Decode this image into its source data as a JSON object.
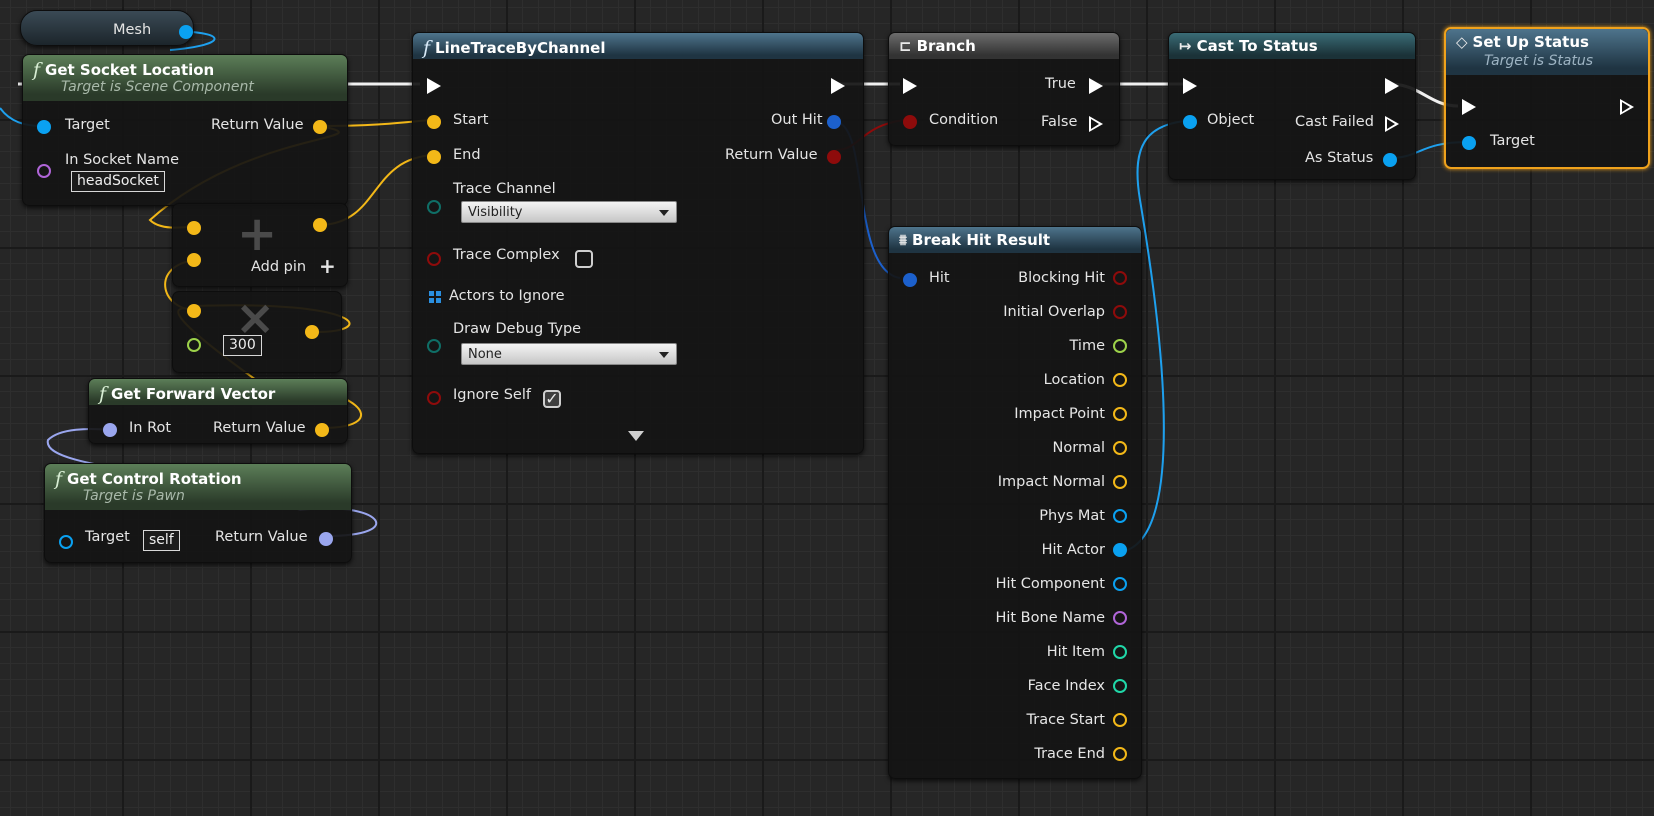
{
  "mesh_node": {
    "label": "Mesh"
  },
  "get_socket_location": {
    "title": "Get Socket Location",
    "subtitle": "Target is Scene Component",
    "target": "Target",
    "return_value": "Return Value",
    "in_socket_name": "In Socket Name",
    "socket_value": "headSocket"
  },
  "add_node": {
    "add_pin": "Add pin"
  },
  "multiply_node": {
    "value": "300"
  },
  "get_forward_vector": {
    "title": "Get Forward Vector",
    "in_rot": "In Rot",
    "return_value": "Return Value"
  },
  "get_control_rotation": {
    "title": "Get Control Rotation",
    "subtitle": "Target is Pawn",
    "target": "Target",
    "target_value": "self",
    "return_value": "Return Value"
  },
  "line_trace": {
    "title": "LineTraceByChannel",
    "start": "Start",
    "end": "End",
    "out_hit": "Out Hit",
    "return_value": "Return Value",
    "trace_channel": "Trace Channel",
    "trace_channel_value": "Visibility",
    "trace_complex": "Trace Complex",
    "actors_to_ignore": "Actors to Ignore",
    "draw_debug_type": "Draw Debug Type",
    "draw_debug_value": "None",
    "ignore_self": "Ignore Self"
  },
  "branch": {
    "title": "Branch",
    "condition": "Condition",
    "true_label": "True",
    "false_label": "False"
  },
  "cast_to_status": {
    "title": "Cast To Status",
    "object": "Object",
    "cast_failed": "Cast Failed",
    "as_status": "As Status"
  },
  "set_up_status": {
    "title": "Set Up Status",
    "subtitle": "Target is Status",
    "target": "Target"
  },
  "break_hit_result": {
    "title": "Break Hit Result",
    "hit": "Hit",
    "outputs": [
      "Blocking Hit",
      "Initial Overlap",
      "Time",
      "Location",
      "Impact Point",
      "Normal",
      "Impact Normal",
      "Phys Mat",
      "Hit Actor",
      "Hit Component",
      "Hit Bone Name",
      "Hit Item",
      "Face Index",
      "Trace Start",
      "Trace End"
    ]
  },
  "colors": {
    "exec": "#ffffff",
    "vector": "#f3b818",
    "float": "#9dd24a",
    "object": "#0aa1f1",
    "struct": "#1c60cc",
    "bool": "#8e0b0b",
    "name": "#b065d8",
    "rotator": "#9aa6ee",
    "int": "#20d7a8",
    "byte": "#0f6e66",
    "selected": "#f0a21c"
  }
}
